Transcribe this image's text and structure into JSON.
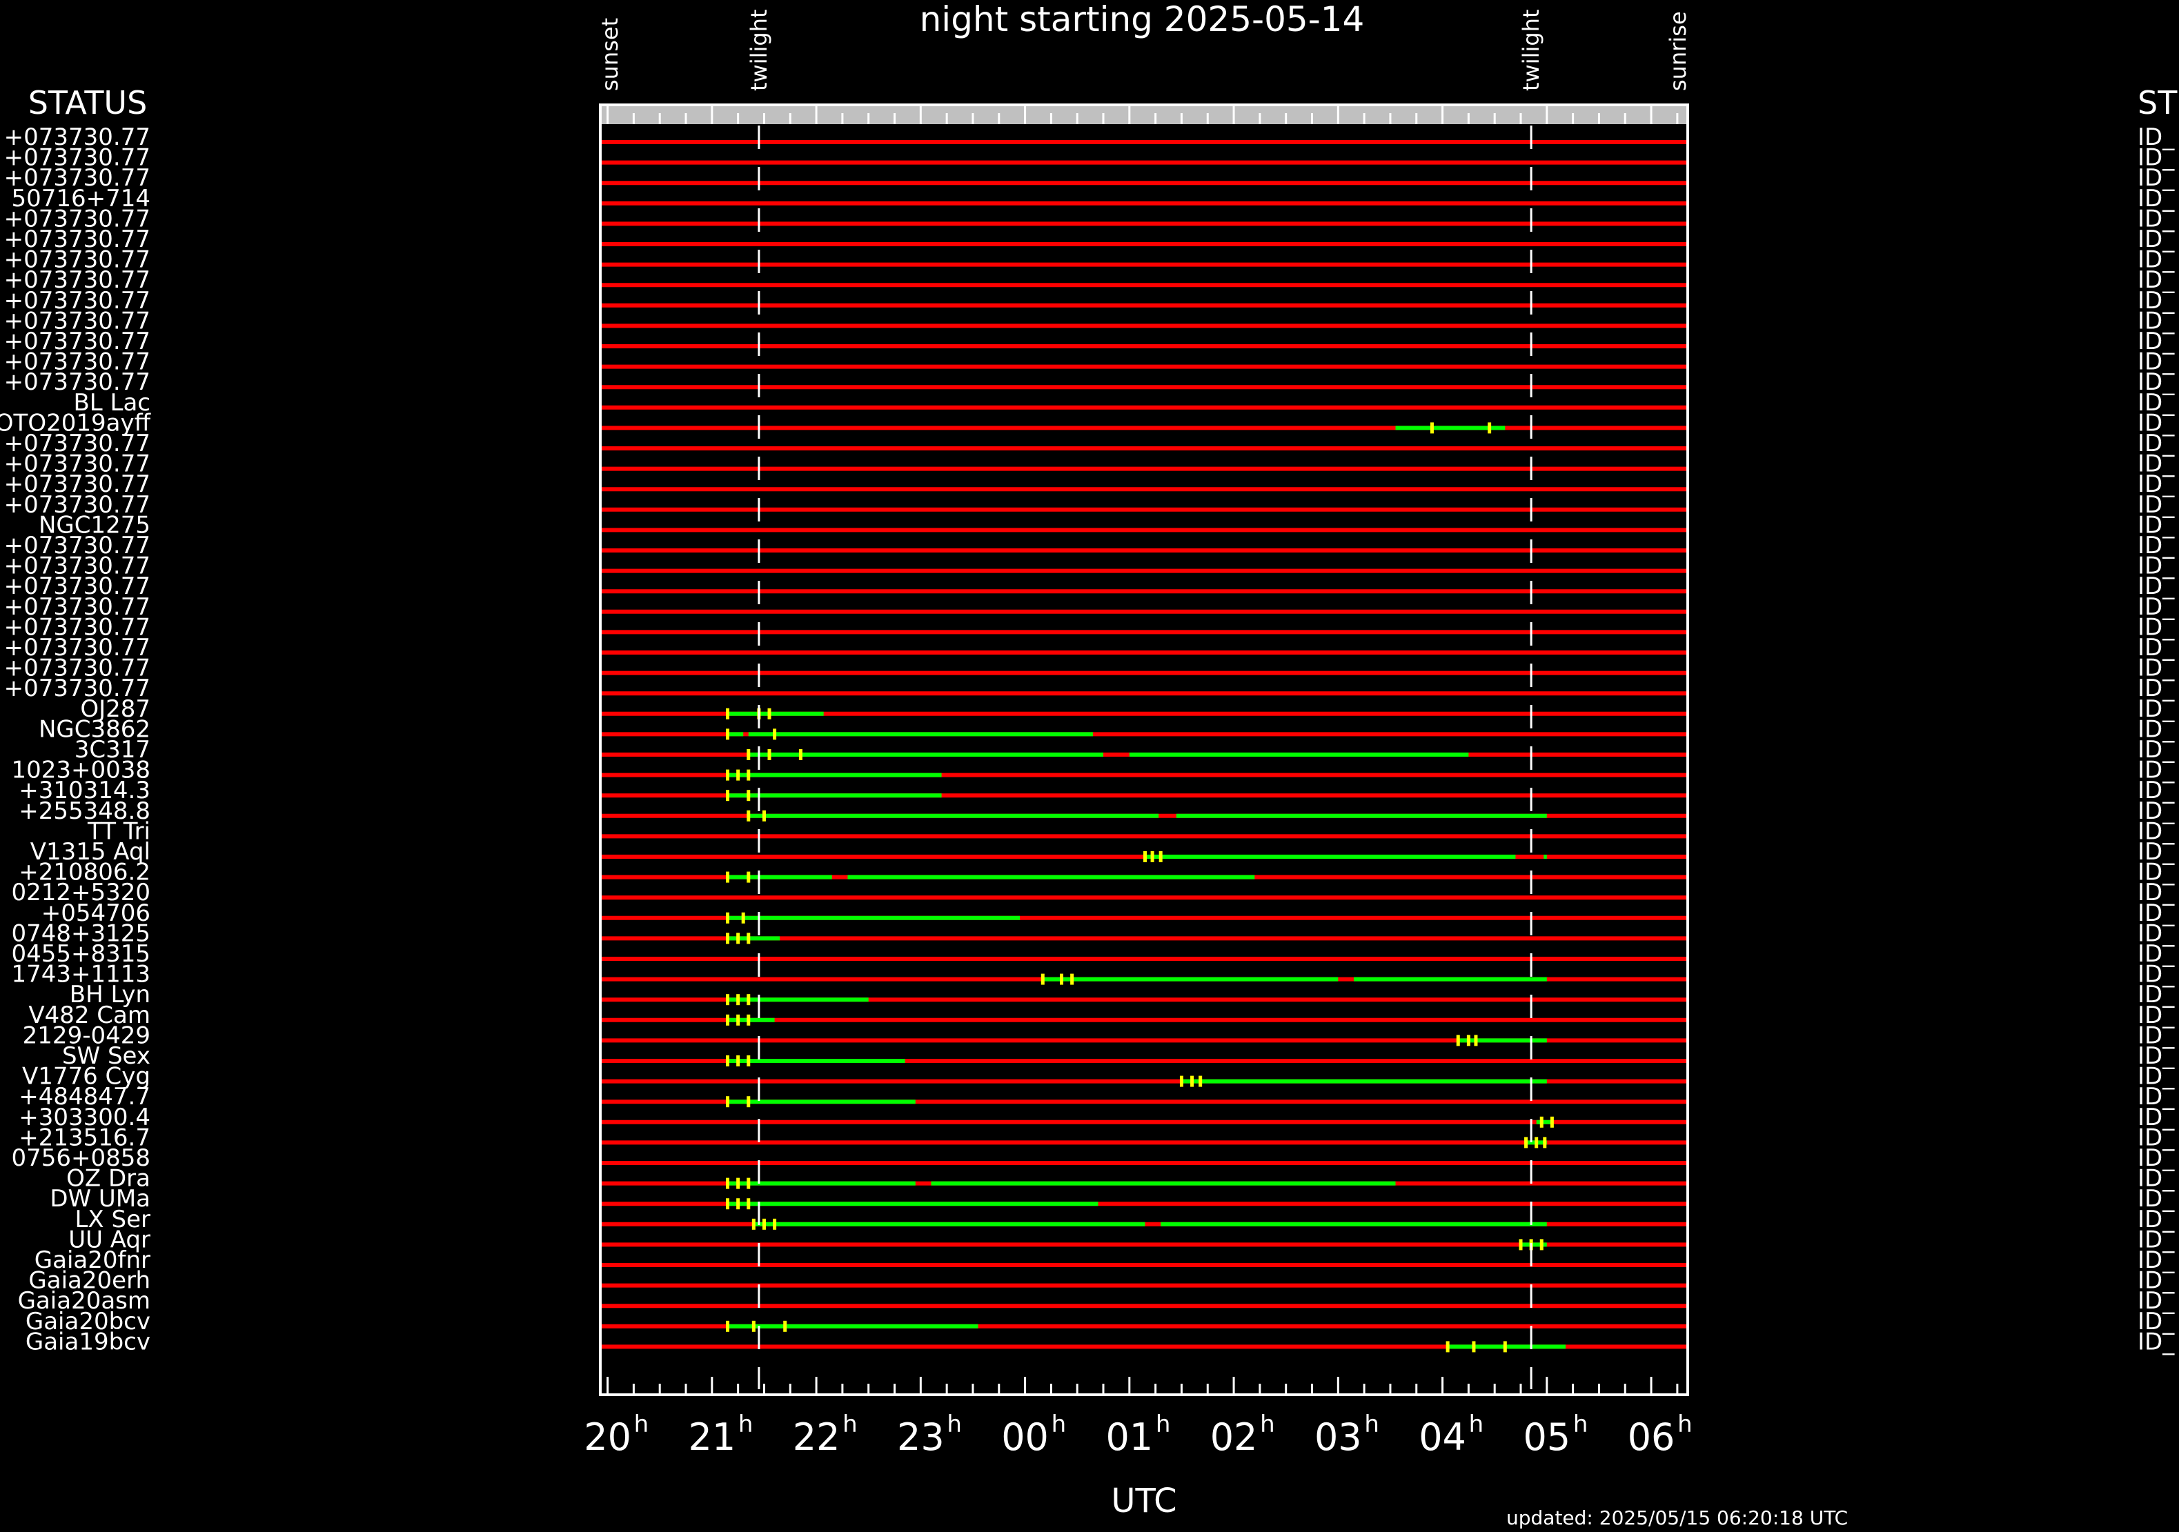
{
  "chart_data": {
    "type": "timeline",
    "title": "night starting 2025-05-14",
    "xlabel": "UTC",
    "status_header": "STATUS",
    "status_header_right": "ST",
    "updated": "updated: 2025/05/15 06:20:18 UTC",
    "x_range": [
      19.93,
      30.35
    ],
    "ticks": [
      "20",
      "21",
      "22",
      "23",
      "00",
      "01",
      "02",
      "03",
      "04",
      "05",
      "06"
    ],
    "tick_hours": [
      20,
      21,
      22,
      23,
      24,
      25,
      26,
      27,
      28,
      29,
      30
    ],
    "events": [
      {
        "label": "sunset",
        "hour": 19.93
      },
      {
        "label": "twilight",
        "hour": 21.45
      },
      {
        "label": "twilight",
        "hour": 28.85
      },
      {
        "label": "sunrise",
        "hour": 30.35
      }
    ],
    "colors": {
      "unobservable": "#ff0000",
      "observable": "#00ff00",
      "marker": "#ffff00",
      "frame": "#ffffff",
      "topbar": "#c0c0c0"
    },
    "right_label": "ID_",
    "rows": [
      {
        "label": "+073730.77",
        "segments": []
      },
      {
        "label": "+073730.77",
        "segments": []
      },
      {
        "label": "+073730.77",
        "segments": []
      },
      {
        "label": "50716+714",
        "segments": []
      },
      {
        "label": "+073730.77",
        "segments": []
      },
      {
        "label": "+073730.77",
        "segments": []
      },
      {
        "label": "+073730.77",
        "segments": []
      },
      {
        "label": "+073730.77",
        "segments": []
      },
      {
        "label": "+073730.77",
        "segments": []
      },
      {
        "label": "+073730.77",
        "segments": []
      },
      {
        "label": "+073730.77",
        "segments": []
      },
      {
        "label": "+073730.77",
        "segments": []
      },
      {
        "label": "+073730.77",
        "segments": []
      },
      {
        "label": "BL Lac",
        "segments": []
      },
      {
        "label": "OTO2019ayff",
        "segments": [
          [
            27.55,
            28.6
          ]
        ],
        "markers": [
          27.9,
          28.45
        ]
      },
      {
        "label": "+073730.77",
        "segments": []
      },
      {
        "label": "+073730.77",
        "segments": []
      },
      {
        "label": "+073730.77",
        "segments": []
      },
      {
        "label": "+073730.77",
        "segments": []
      },
      {
        "label": "NGC1275",
        "segments": []
      },
      {
        "label": "+073730.77",
        "segments": []
      },
      {
        "label": "+073730.77",
        "segments": []
      },
      {
        "label": "+073730.77",
        "segments": []
      },
      {
        "label": "+073730.77",
        "segments": []
      },
      {
        "label": "+073730.77",
        "segments": []
      },
      {
        "label": "+073730.77",
        "segments": []
      },
      {
        "label": "+073730.77",
        "segments": []
      },
      {
        "label": "+073730.77",
        "segments": []
      },
      {
        "label": "OJ287",
        "segments": [
          [
            21.15,
            22.07
          ]
        ],
        "markers": [
          21.15,
          21.45,
          21.55
        ]
      },
      {
        "label": "NGC3862",
        "segments": [
          [
            21.15,
            21.3
          ],
          [
            21.35,
            24.65
          ]
        ],
        "markers": [
          21.15,
          21.6
        ]
      },
      {
        "label": "3C317",
        "segments": [
          [
            21.35,
            24.75
          ],
          [
            25.0,
            28.25
          ]
        ],
        "markers": [
          21.35,
          21.55,
          21.85
        ]
      },
      {
        "label": "1023+0038",
        "segments": [
          [
            21.15,
            23.2
          ]
        ],
        "markers": [
          21.15,
          21.25,
          21.35
        ]
      },
      {
        "label": "+310314.3",
        "segments": [
          [
            21.15,
            23.2
          ]
        ],
        "markers": [
          21.15,
          21.35
        ]
      },
      {
        "label": "+255348.8",
        "segments": [
          [
            21.35,
            25.28
          ],
          [
            25.45,
            29.0
          ]
        ],
        "markers": [
          21.35,
          21.5
        ]
      },
      {
        "label": "TT Tri",
        "segments": []
      },
      {
        "label": "V1315 Aql",
        "segments": [
          [
            25.15,
            28.7
          ],
          [
            28.97,
            29.0
          ]
        ],
        "markers": [
          25.15,
          25.22,
          25.3
        ]
      },
      {
        "label": "+210806.2",
        "segments": [
          [
            21.15,
            22.15
          ],
          [
            22.3,
            26.2
          ]
        ],
        "markers": [
          21.15,
          21.35
        ]
      },
      {
        "label": "0212+5320",
        "segments": []
      },
      {
        "label": "+054706",
        "segments": [
          [
            21.15,
            23.95
          ]
        ],
        "markers": [
          21.15,
          21.3
        ]
      },
      {
        "label": "0748+3125",
        "segments": [
          [
            21.15,
            21.65
          ]
        ],
        "markers": [
          21.15,
          21.25,
          21.35
        ]
      },
      {
        "label": "0455+8315",
        "segments": []
      },
      {
        "label": "1743+1113",
        "segments": [
          [
            24.17,
            27.0
          ],
          [
            27.15,
            29.0
          ]
        ],
        "markers": [
          24.17,
          24.35,
          24.45
        ]
      },
      {
        "label": "BH Lyn",
        "segments": [
          [
            21.15,
            22.5
          ]
        ],
        "markers": [
          21.15,
          21.25,
          21.35
        ]
      },
      {
        "label": "V482 Cam",
        "segments": [
          [
            21.15,
            21.6
          ]
        ],
        "markers": [
          21.15,
          21.25,
          21.35
        ]
      },
      {
        "label": "2129-0429",
        "segments": [
          [
            28.15,
            29.0
          ]
        ],
        "markers": [
          28.15,
          28.25,
          28.32
        ]
      },
      {
        "label": "SW Sex",
        "segments": [
          [
            21.15,
            22.85
          ]
        ],
        "markers": [
          21.15,
          21.25,
          21.35
        ]
      },
      {
        "label": "V1776 Cyg",
        "segments": [
          [
            25.5,
            29.0
          ]
        ],
        "markers": [
          25.5,
          25.6,
          25.68
        ]
      },
      {
        "label": "+484847.7",
        "segments": [
          [
            21.15,
            22.95
          ]
        ],
        "markers": [
          21.15,
          21.35
        ]
      },
      {
        "label": "+303300.4",
        "segments": [
          [
            28.9,
            29.05
          ]
        ],
        "markers": [
          28.95,
          29.05
        ]
      },
      {
        "label": "+213516.7",
        "segments": [
          [
            28.8,
            29.0
          ]
        ],
        "markers": [
          28.8,
          28.9,
          28.98
        ]
      },
      {
        "label": "0756+0858",
        "segments": []
      },
      {
        "label": "OZ Dra",
        "segments": [
          [
            21.15,
            22.95
          ],
          [
            23.1,
            27.55
          ]
        ],
        "markers": [
          21.15,
          21.25,
          21.35
        ]
      },
      {
        "label": "DW UMa",
        "segments": [
          [
            21.15,
            24.7
          ]
        ],
        "markers": [
          21.15,
          21.25,
          21.35
        ]
      },
      {
        "label": "LX Ser",
        "segments": [
          [
            21.4,
            25.15
          ],
          [
            25.3,
            29.0
          ]
        ],
        "markers": [
          21.4,
          21.5,
          21.6
        ]
      },
      {
        "label": "UU Aqr",
        "segments": [
          [
            28.75,
            29.0
          ]
        ],
        "markers": [
          28.75,
          28.85,
          28.95
        ]
      },
      {
        "label": "Gaia20fnr",
        "segments": []
      },
      {
        "label": "Gaia20erh",
        "segments": []
      },
      {
        "label": "Gaia20asm",
        "segments": []
      },
      {
        "label": "Gaia20bcv",
        "segments": [
          [
            21.15,
            23.55
          ]
        ],
        "markers": [
          21.15,
          21.4,
          21.7
        ]
      },
      {
        "label": "Gaia19bcv",
        "segments": [
          [
            28.05,
            29.18
          ]
        ],
        "markers": [
          28.05,
          28.3,
          28.6
        ]
      }
    ]
  }
}
